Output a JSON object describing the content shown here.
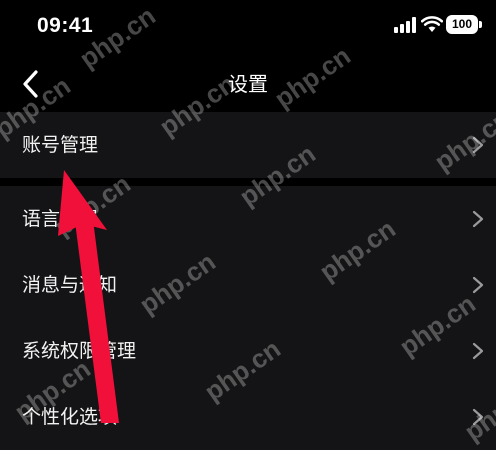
{
  "status_bar": {
    "time": "09:41",
    "battery": "100"
  },
  "nav": {
    "title": "设置"
  },
  "settings": {
    "items": [
      {
        "label": "账号管理"
      },
      {
        "label": "语言设置"
      },
      {
        "label": "消息与通知"
      },
      {
        "label": "系统权限管理"
      },
      {
        "label": "个性化选项"
      }
    ]
  },
  "watermark": "php.cn",
  "colors": {
    "background": "#000000",
    "row_background": "#141416",
    "arrow": "#f0103a"
  },
  "icons": {
    "back": "chevron-left-icon",
    "row": "chevron-right-icon"
  }
}
